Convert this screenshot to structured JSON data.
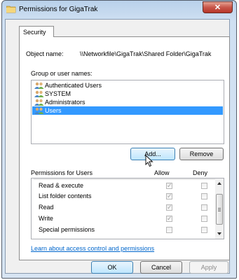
{
  "window": {
    "title": "Permissions for GigaTrak",
    "close_glyph": "✕"
  },
  "tabs": [
    {
      "label": "Security"
    }
  ],
  "object": {
    "label": "Object name:",
    "value": "\\\\Networkfile\\GigaTrak\\Shared Folder\\GigaTrak"
  },
  "groups": {
    "label": "Group or user names:",
    "items": [
      {
        "label": "Authenticated Users",
        "icon": "users-group-icon",
        "selected": false
      },
      {
        "label": "SYSTEM",
        "icon": "users-group-icon",
        "selected": false
      },
      {
        "label": "Administrators",
        "icon": "users-group-icon",
        "selected": false
      },
      {
        "label": "Users",
        "icon": "users-group-icon",
        "selected": true
      }
    ]
  },
  "buttons": {
    "add": "Add...",
    "remove": "Remove",
    "ok": "OK",
    "cancel": "Cancel",
    "apply": "Apply"
  },
  "permissions": {
    "label": "Permissions for Users",
    "allow_header": "Allow",
    "deny_header": "Deny",
    "rows": [
      {
        "name": "Read & execute",
        "allow": true,
        "deny": false
      },
      {
        "name": "List folder contents",
        "allow": true,
        "deny": false
      },
      {
        "name": "Read",
        "allow": true,
        "deny": false
      },
      {
        "name": "Write",
        "allow": true,
        "deny": false
      },
      {
        "name": "Special permissions",
        "allow": false,
        "deny": false
      }
    ]
  },
  "link": {
    "label": "Learn about access control and permissions"
  },
  "colors": {
    "selection": "#3399ff",
    "link": "#0066cc",
    "titlebar": "#b9d1ea",
    "close": "#c8574a"
  }
}
